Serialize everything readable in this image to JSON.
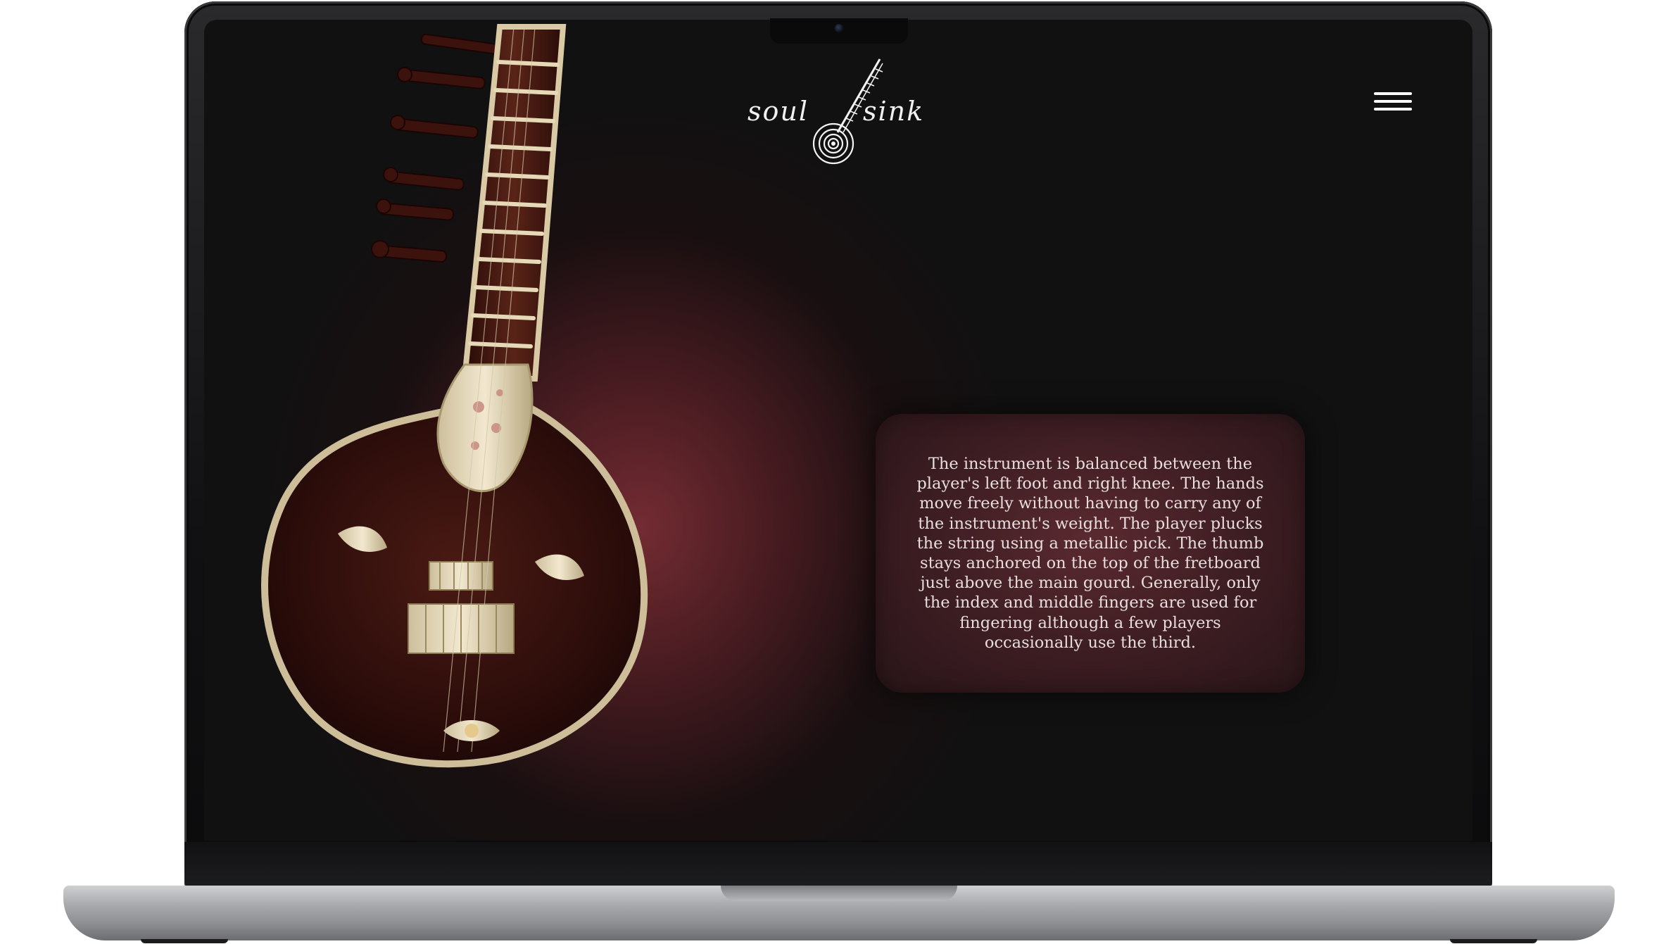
{
  "site": {
    "logo": {
      "word_left": "soul",
      "word_right": "sink",
      "icon": "sitar-vinyl-logo-icon"
    },
    "menu_icon": "hamburger-menu-icon",
    "hero_image_icon": "sitar-instrument-image"
  },
  "info_card": {
    "text": "The instrument is balanced between the player's left foot and right knee. The hands move freely without having to carry any of the instrument's weight. The player plucks the string using a metallic pick. The thumb stays anchored on the top of the fretboard just above the main gourd. Generally, only the index and middle fingers are used for fingering although a few players occasionally use the third."
  },
  "colors": {
    "background": "#111111",
    "glow": "#7a2d34",
    "card": "#4a2328",
    "text": "#e9dede",
    "wood": "#3a1410",
    "ivory": "#e8dcc0"
  }
}
